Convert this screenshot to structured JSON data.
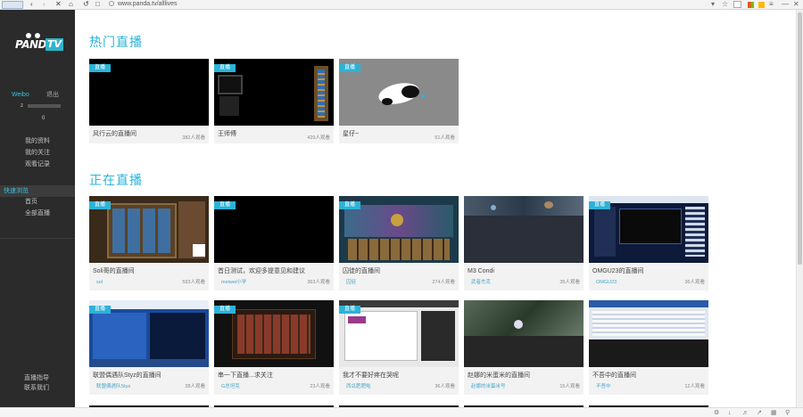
{
  "browser": {
    "url": "www.panda.tv/alllives",
    "icons": [
      "back-icon",
      "forward-icon",
      "close-icon",
      "home-icon",
      "refresh-icon",
      "star-icon",
      "bookmark-icon",
      "menu-icon"
    ]
  },
  "sidebar": {
    "logo_text_1": "PANDA",
    "logo_text_2": "TV",
    "tab_a": "Weibo",
    "tab_b": "退出",
    "small_1": "z",
    "small_2": "0",
    "links": [
      "我的资料",
      "我的关注",
      "观看记录"
    ],
    "active": "快速浏览",
    "links2": [
      "首页",
      "全部直播"
    ],
    "bottom": [
      "直播指导",
      "联系我们"
    ]
  },
  "sections": {
    "hot": "热门直播",
    "live": "正在直播"
  },
  "badge": "直播",
  "hot_cards": [
    {
      "title": "风行云的直播间",
      "viewers": "382人观看"
    },
    {
      "title": "王师傅",
      "viewers": "429人观看"
    },
    {
      "title": "星仔~",
      "viewers": "61人观看"
    }
  ],
  "live_row1": [
    {
      "title": "Soli哥的直播间",
      "host": "sol",
      "viewers": "593人观看"
    },
    {
      "title": "首日测试，欢迎多提意见和建议",
      "host": "meiwei小学",
      "viewers": "363人观看"
    },
    {
      "title": "囚徒的直播间",
      "host": "囚徒",
      "viewers": "274人观看"
    },
    {
      "title": "M3 Condi",
      "host": "武者杰克",
      "viewers": "35人观看"
    },
    {
      "title": "OMGU23的直播间",
      "host": "OMGU23",
      "viewers": "36人观看"
    }
  ],
  "live_row2": [
    {
      "title": "联盟偶遇队Styz的直播间",
      "host": "联盟偶遇队Stys",
      "viewers": "28人观看"
    },
    {
      "title": "串一下直播...求关注",
      "host": "G总坦克",
      "viewers": "23人观看"
    },
    {
      "title": "我才不要好疼在哭呢",
      "host": "西瓜肥肥啦",
      "viewers": "36人观看"
    },
    {
      "title": "赵娜的米蛋米的直播间",
      "host": "赵娜的米蛋米号",
      "viewers": "15人观看"
    },
    {
      "title": "不吾中的直播间",
      "host": "不吾中",
      "viewers": "12人观看"
    }
  ]
}
